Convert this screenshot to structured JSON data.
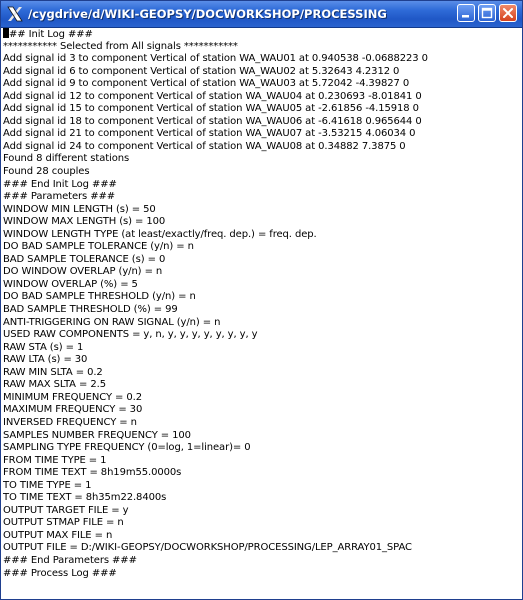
{
  "window": {
    "title": "/cygdrive/d/WIKI-GEOPSY/DOCWORKSHOP/PROCESSING",
    "icon": "x-terminal-icon"
  },
  "title_buttons": {
    "minimize": "minimize-icon",
    "maximize": "maximize-icon",
    "close": "close-icon"
  },
  "colors": {
    "titlebar": "#2f6bd8",
    "close_button": "#d5421e",
    "terminal_bg": "#ffffff",
    "terminal_fg": "#000000"
  },
  "terminal": {
    "first_line_rest": "## Init Log ###",
    "lines": [
      "*********** Selected from All signals ***********",
      "Add signal id 3 to component Vertical of station WA_WAU01 at 0.940538 -0.0688223 0",
      "Add signal id 6 to component Vertical of station WA_WAU02 at 5.32643 4.2312 0",
      "Add signal id 9 to component Vertical of station WA_WAU03 at 5.72042 -4.39827 0",
      "Add signal id 12 to component Vertical of station WA_WAU04 at 0.230693 -8.01841 0",
      "Add signal id 15 to component Vertical of station WA_WAU05 at -2.61856 -4.15918 0",
      "Add signal id 18 to component Vertical of station WA_WAU06 at -6.41618 0.965644 0",
      "Add signal id 21 to component Vertical of station WA_WAU07 at -3.53215 4.06034 0",
      "Add signal id 24 to component Vertical of station WA_WAU08 at 0.34882 7.3875 0",
      "Found 8 different stations",
      "Found 28 couples",
      "### End Init Log ###",
      "### Parameters ###",
      "WINDOW MIN LENGTH (s) = 50",
      "WINDOW MAX LENGTH (s) = 100",
      "WINDOW LENGTH TYPE (at least/exactly/freq. dep.) = freq. dep.",
      "DO BAD SAMPLE TOLERANCE (y/n) = n",
      "BAD SAMPLE TOLERANCE (s) = 0",
      "DO WINDOW OVERLAP (y/n) = n",
      "WINDOW OVERLAP (%) = 5",
      "DO BAD SAMPLE THRESHOLD (y/n) = n",
      "BAD SAMPLE THRESHOLD (%) = 99",
      "ANTI-TRIGGERING ON RAW SIGNAL (y/n) = n",
      "USED RAW COMPONENTS = y, n, y, y, y, y, y, y, y, y",
      "RAW STA (s) = 1",
      "RAW LTA (s) = 30",
      "RAW MIN SLTA = 0.2",
      "RAW MAX SLTA = 2.5",
      "MINIMUM FREQUENCY = 0.2",
      "MAXIMUM FREQUENCY = 30",
      "INVERSED FREQUENCY = n",
      "SAMPLES NUMBER FREQUENCY = 100",
      "SAMPLING TYPE FREQUENCY (0=log, 1=linear)= 0",
      "FROM TIME TYPE = 1",
      "FROM TIME TEXT = 8h19m55.0000s",
      "TO TIME TYPE = 1",
      "TO TIME TEXT = 8h35m22.8400s",
      "OUTPUT TARGET FILE = y",
      "OUTPUT STMAP FILE = n",
      "OUTPUT MAX FILE = n",
      "OUTPUT FILE = D:/WIKI-GEOPSY/DOCWORKSHOP/PROCESSING/LEP_ARRAY01_SPAC",
      "### End Parameters ###",
      "### Process Log ###"
    ]
  }
}
